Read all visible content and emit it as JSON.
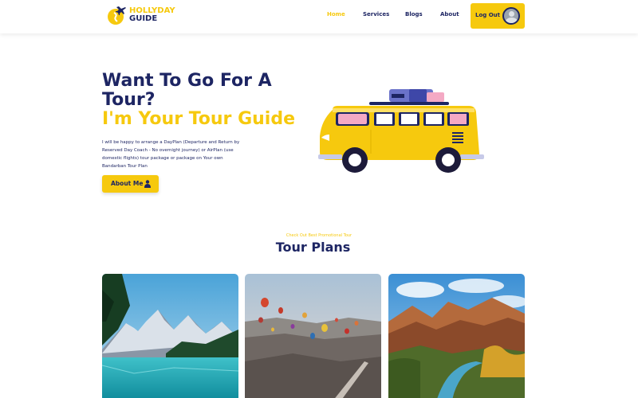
{
  "brand": {
    "line1": "HOLLYDAY",
    "line2": "GUIDE"
  },
  "nav": {
    "items": [
      "Home",
      "Services",
      "Blogs",
      "About"
    ],
    "active": "Home",
    "logout_label": "Log Out"
  },
  "hero": {
    "title_line1": "Want To Go For A Tour?",
    "title_line2": "I'm Your Tour Guide",
    "description": "I will be happy to arrange a DayPlan (Departure and Return by Reserved Day Coach - No overnight journey) or AirPlan (use domestic flights) tour package or package on Your own Bandarban Tour Plan",
    "cta_label": "About Me"
  },
  "tours": {
    "kicker": "Check Out Best Promotional Tour",
    "title": "Tour Plans",
    "cards": [
      "mountain-lake-photo",
      "hot-air-balloons-photo",
      "canyon-river-photo"
    ]
  },
  "colors": {
    "accent": "#f6c90e",
    "navy": "#1d2563"
  }
}
